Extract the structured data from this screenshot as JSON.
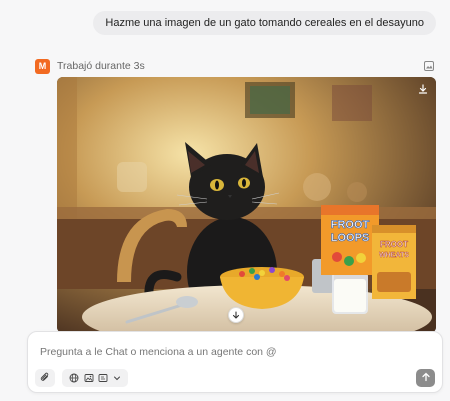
{
  "conversation": {
    "user_message": "Hazme una imagen de un gato tomando cereales en el desayuno",
    "assistant": {
      "avatar_letter": "M",
      "status": "Trabajó durante 3s",
      "image": {
        "cereal_box_1": {
          "line1": "FROOT",
          "line2": "LOOPS"
        },
        "cereal_box_2": {
          "line1": "FROOT",
          "line2": "WHEATS"
        }
      }
    }
  },
  "composer": {
    "placeholder": "Pregunta a le Chat o menciona a un agente con @",
    "value": ""
  },
  "colors": {
    "brand": "#f26a21",
    "send_button": "#8c8c8c",
    "user_bubble": "#ececee"
  },
  "icons": [
    "image-toggle-icon",
    "download-icon",
    "arrow-down-icon",
    "paperclip-icon",
    "globe-icon",
    "image-icon",
    "canvas-icon",
    "chevron-down-icon",
    "arrow-up-icon"
  ]
}
